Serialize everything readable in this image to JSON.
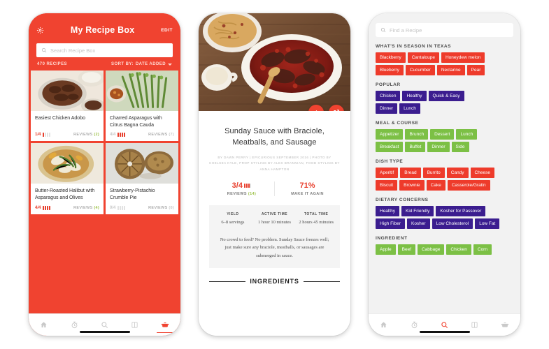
{
  "palette": {
    "brand_red": "#f04330",
    "tag_red": "#ee3b2b",
    "tag_purple": "#3b1d8f",
    "tag_green": "#7cc045",
    "rating_green": "#9ec24a",
    "screen_grey": "#f2f2f2"
  },
  "phone1": {
    "header": {
      "gear_icon": "gear-icon",
      "title": "My Recipe Box",
      "edit_label": "EDIT"
    },
    "search": {
      "icon": "search-icon",
      "placeholder": "Search Recipe Box"
    },
    "sortbar": {
      "count_label": "470 RECIPES",
      "sort_label": "SORT BY:",
      "sort_value": "DATE ADDED",
      "caret_icon": "chevron-down-icon"
    },
    "cards": [
      {
        "title": "Easiest Chicken Adobo",
        "rating": "1/4",
        "forks_filled": 1,
        "reviews_label": "REVIEWS",
        "reviews_count": "(2)",
        "dim": false
      },
      {
        "title": "Charred Asparagus with Citrus Bagna Cauda",
        "rating": "4/4",
        "forks_filled": 4,
        "reviews_label": "REVIEWS",
        "reviews_count": "(7)",
        "dim": true
      },
      {
        "title": "Butter-Roasted Halibut with Asparagus and Olives",
        "rating": "4/4",
        "forks_filled": 4,
        "reviews_label": "REVIEWS",
        "reviews_count": "(4)",
        "dim": false
      },
      {
        "title": "Strawberry-Pistachio Crumble Pie",
        "rating": "0/4",
        "forks_filled": 0,
        "reviews_label": "REVIEWS",
        "reviews_count": "(0)",
        "dim": true
      }
    ],
    "nav": {
      "items": [
        {
          "icon": "home-icon",
          "active": false
        },
        {
          "icon": "timer-icon",
          "active": false
        },
        {
          "icon": "search-icon",
          "active": false
        },
        {
          "icon": "book-icon",
          "active": false
        },
        {
          "icon": "pot-icon",
          "active": true
        }
      ]
    }
  },
  "phone2": {
    "hero": {
      "image_alt": "sunday-sauce-hero-photo",
      "add_button_icon": "plus-icon",
      "share_button_icon": "share-icon"
    },
    "title": "Sunday Sauce with Braciole, Meatballs, and Sausage",
    "byline": "BY DAWN PERRY | EPICURIOUS SEPTEMBER 2016 | PHOTO BY CHELSEA KYLE, PROP STYLING BY ALEX BRANNIAN, FOOD STYLING BY ANNA HAMPTON",
    "stats": [
      {
        "value": "3/4",
        "forks_filled": 3,
        "label_prefix": "REVIEWS",
        "label_count": "(14)"
      },
      {
        "value": "71%",
        "label_prefix": "MAKE IT AGAIN",
        "label_count": ""
      }
    ],
    "meta": [
      {
        "heading": "YIELD",
        "value": "6–8 servings"
      },
      {
        "heading": "ACTIVE TIME",
        "value": "1 hour 10 minutes"
      },
      {
        "heading": "TOTAL TIME",
        "value": "2 hours 45 minutes"
      }
    ],
    "description": "No crowd to feed? No problem. Sunday Sauce freezes well; just make sure any braciole, meatballs, or sausages are submerged in sauce.",
    "ingredients_heading": "INGREDIENTS"
  },
  "phone3": {
    "search": {
      "icon": "search-icon",
      "placeholder": "Find a Recipe"
    },
    "sections": [
      {
        "heading": "WHAT'S IN SEASON IN TEXAS",
        "color": "#ee3b2b",
        "rows": [
          [
            "Blackberry",
            "Cantaloupe",
            "Honeydew melon"
          ],
          [
            "Blueberry",
            "Cucumber",
            "Nectarine",
            "Pear"
          ]
        ]
      },
      {
        "heading": "POPULAR",
        "color": "#3b1d8f",
        "rows": [
          [
            "Chicken",
            "Healthy",
            "Quick & Easy"
          ],
          [
            "Dinner",
            "Lunch"
          ]
        ]
      },
      {
        "heading": "MEAL & COURSE",
        "color": "#7cc045",
        "rows": [
          [
            "Appetizer",
            "Brunch",
            "Dessert",
            "Lunch"
          ],
          [
            "Breakfast",
            "Buffet",
            "Dinner",
            "Side"
          ]
        ]
      },
      {
        "heading": "DISH TYPE",
        "color": "#ee3b2b",
        "rows": [
          [
            "Aperitif",
            "Bread",
            "Burrito",
            "Candy",
            "Cheese"
          ],
          [
            "Biscuit",
            "Brownie",
            "Cake",
            "Casserole/Gratin"
          ]
        ]
      },
      {
        "heading": "DIETARY CONCERNS",
        "color": "#3b1d8f",
        "rows": [
          [
            "Healthy",
            "Kid Friendly",
            "Kosher for Passover"
          ],
          [
            "High Fiber",
            "Kosher",
            "Low Cholesterol",
            "Low Fat"
          ]
        ]
      },
      {
        "heading": "INGREDIENT",
        "color": "#7cc045",
        "rows": [
          [
            "Apple",
            "Beef",
            "Cabbage",
            "Chicken",
            "Corn"
          ]
        ]
      }
    ],
    "nav": {
      "items": [
        {
          "icon": "home-icon",
          "active": false
        },
        {
          "icon": "timer-icon",
          "active": false
        },
        {
          "icon": "search-icon",
          "active": true
        },
        {
          "icon": "book-icon",
          "active": false
        },
        {
          "icon": "pot-icon",
          "active": false
        }
      ]
    }
  }
}
